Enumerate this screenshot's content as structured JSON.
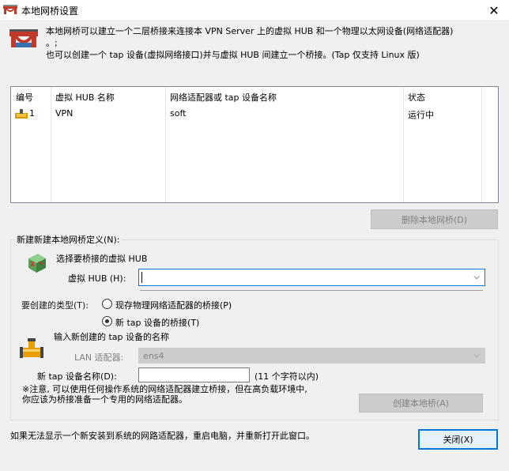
{
  "window": {
    "title": "本地网桥设置",
    "close_glyph": "✕"
  },
  "intro": {
    "text": "本地网桥可以建立一个二层桥接来连接本 VPN Server 上的虚拟 HUB 和一个物理以太网设备(网络适配器)\n。;\n也可以创建一个 tap 设备(虚拟网络接口)并与虚拟 HUB 间建立一个桥接。(Tap 仅支持 Linux 版)"
  },
  "table": {
    "headers": {
      "id": "编号",
      "hub": "虚拟 HUB 名称",
      "adapter": "网络适配器或 tap 设备名称",
      "status": "状态"
    },
    "rows": [
      {
        "id": "1",
        "hub": "VPN",
        "adapter": "soft",
        "status": "运行中"
      }
    ]
  },
  "buttons": {
    "delete_bridge": "删除本地网桥(D)",
    "create_bridge": "创建本地桥(A)",
    "close": "关闭(X)"
  },
  "new_bridge": {
    "group_label": "新建新建本地网桥定义(N):",
    "select_hub_heading": "选择要桥接的虚拟 HUB",
    "hub_label": "虚拟 HUB (H):",
    "hub_value": "",
    "type_label": "要创建的类型(T):",
    "radio_physical": "现存物理网络适配器的桥接(P)",
    "radio_tap": "新 tap 设备的桥接(T)",
    "selected_type": "tap",
    "tap_heading": "输入新创建的 tap 设备的名称",
    "lan_label": "LAN 适配器:",
    "lan_value": "ens4",
    "tap_name_label": "新 tap 设备名称(D):",
    "tap_name_value": "",
    "tap_name_hint": "(11 个字符以内)",
    "note": "※注意, 可以使用任何操作系统的网络适配器建立桥接，但在高负载环境中,\n你应该为桥接准备一个专用的网络适配器。"
  },
  "footer": {
    "text": "如果无法显示一个新安装到系统的网路适配器，重启电脑，并重新打开此窗口。"
  },
  "icons": {
    "title": "bridge-icon",
    "intro": "bridge-icon",
    "row": "ethernet-icon",
    "hub": "hub-icon",
    "tap": "pipe-icon"
  },
  "colors": {
    "accent": "#0078d7",
    "bridge_red": "#c0392b",
    "hub_green": "#5aa05a",
    "pipe_orange": "#e8a000"
  }
}
